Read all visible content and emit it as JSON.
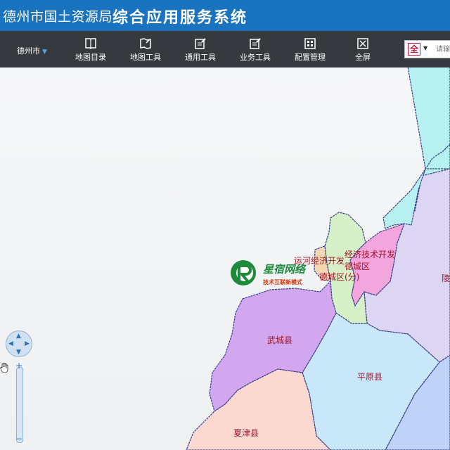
{
  "header": {
    "org_name": "德州市国土资源局",
    "system_name": "综合应用服务系统",
    "color": "#1a73bf"
  },
  "toolbar": {
    "city": "德州市",
    "items": [
      {
        "label": "地图目录",
        "icon": "book-icon"
      },
      {
        "label": "地图工具",
        "icon": "map-tool-icon"
      },
      {
        "label": "通用工具",
        "icon": "edit-icon"
      },
      {
        "label": "业务工具",
        "icon": "edit-doc-icon"
      },
      {
        "label": "配置管理",
        "icon": "config-icon"
      },
      {
        "label": "全屏",
        "icon": "fullscreen-icon"
      }
    ],
    "search": {
      "scope": "全",
      "placeholder": "请输"
    }
  },
  "map": {
    "regions": [
      {
        "id": "lingcheng",
        "label": "陵",
        "color": "#ddd6f2"
      },
      {
        "id": "decheng",
        "label": "德城区",
        "color": "#f2a6dd"
      },
      {
        "id": "jingji",
        "label": "经济技术开发",
        "color": "#d6f0c7"
      },
      {
        "id": "yunhe",
        "label": "运河经济开发",
        "color": "#f4d6b2"
      },
      {
        "id": "decheng_fen",
        "label": "德城区(分)",
        "color": "#d6f0c7"
      },
      {
        "id": "wucheng",
        "label": "武城县",
        "color": "#d2a7f0"
      },
      {
        "id": "pingyuan",
        "label": "平原县",
        "color": "#c8e8f9"
      },
      {
        "id": "xiajin",
        "label": "夏津县",
        "color": "#fbd9d1"
      },
      {
        "id": "ningjin",
        "label": "",
        "color": "#b7f0f0"
      },
      {
        "id": "southeast",
        "label": "",
        "color": "#bfd2f7"
      }
    ],
    "label_color": "#a0182e",
    "watermark": {
      "main": "星宿网络",
      "sub": "技术互联新模式"
    }
  },
  "controls": {
    "pan": {
      "up": "▲",
      "down": "▼",
      "left": "◀",
      "right": "▶"
    },
    "zoom": {
      "in": "+",
      "out": "−"
    }
  }
}
